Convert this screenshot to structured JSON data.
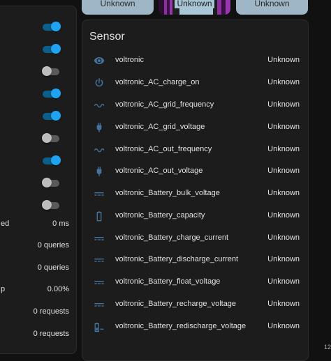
{
  "left_panel": {
    "toggles": [
      "on",
      "on",
      "off",
      "on",
      "on",
      "off",
      "on",
      "off",
      "off"
    ],
    "stats": [
      {
        "label": "ed",
        "value": "0 ms"
      },
      {
        "label": "",
        "value": "0 queries"
      },
      {
        "label": "",
        "value": "0 queries"
      },
      {
        "label": "p",
        "value": "0.00%"
      },
      {
        "label": "",
        "value": "0 requests"
      },
      {
        "label": "",
        "value": "0 requests"
      }
    ]
  },
  "top_buttons": [
    {
      "label": "Unknown"
    },
    {
      "label": "Unknown"
    },
    {
      "label": "Unknown"
    }
  ],
  "sensor_card": {
    "title": "Sensor",
    "rows": [
      {
        "icon": "eye-icon",
        "name": "voltronic",
        "state": "Unknown"
      },
      {
        "icon": "power-icon",
        "name": "voltronic_AC_charge_on",
        "state": "Unknown"
      },
      {
        "icon": "sine-wave-icon",
        "name": "voltronic_AC_grid_frequency",
        "state": "Unknown"
      },
      {
        "icon": "power-plug-icon",
        "name": "voltronic_AC_grid_voltage",
        "state": "Unknown"
      },
      {
        "icon": "sine-wave-icon",
        "name": "voltronic_AC_out_frequency",
        "state": "Unknown"
      },
      {
        "icon": "power-plug-icon",
        "name": "voltronic_AC_out_voltage",
        "state": "Unknown"
      },
      {
        "icon": "current-dc-icon",
        "name": "voltronic_Battery_bulk_voltage",
        "state": "Unknown"
      },
      {
        "icon": "battery-outline-icon",
        "name": "voltronic_Battery_capacity",
        "state": "Unknown"
      },
      {
        "icon": "current-dc-icon",
        "name": "voltronic_Battery_charge_current",
        "state": "Unknown"
      },
      {
        "icon": "current-dc-icon",
        "name": "voltronic_Battery_discharge_current",
        "state": "Unknown"
      },
      {
        "icon": "current-dc-icon",
        "name": "voltronic_Battery_float_voltage",
        "state": "Unknown"
      },
      {
        "icon": "current-dc-icon",
        "name": "voltronic_Battery_recharge_voltage",
        "state": "Unknown"
      },
      {
        "icon": "battery-minus-icon",
        "name": "voltronic_Battery_redischarge_voltage",
        "state": "Unknown"
      }
    ]
  },
  "corner_number": "12",
  "colors": {
    "accent": "#1fa3f0",
    "icon": "#44739e",
    "button": "#9fb6c6"
  }
}
